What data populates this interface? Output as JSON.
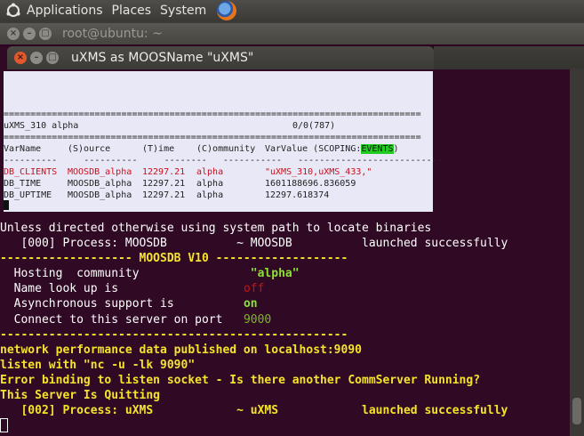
{
  "top_panel": {
    "menus": [
      "Applications",
      "Places",
      "System"
    ]
  },
  "back_window": {
    "title": "root@ubuntu: ~"
  },
  "front_window": {
    "title": "uXMS as MOOSName \"uXMS\""
  },
  "uxms": {
    "separator": "==============================================================================",
    "header_name": "uXMS_310 alpha",
    "header_count": "0/0(787)",
    "columns": {
      "varname": "VarName",
      "source": "(S)ource",
      "time": "(T)ime",
      "community": "(C)ommunity",
      "value": "VarValue (SCOPING:",
      "events": "EVENTS",
      "close": ")"
    },
    "dashes": "----------     ----------     --------   -----------   ---------------------------",
    "rows": [
      {
        "var": "DB_CLIENTS",
        "src": "MOOSDB_alpha",
        "time": "12297.21",
        "comm": "alpha",
        "val": "\"uXMS_310,uXMS_433,\""
      },
      {
        "var": "DB_TIME",
        "src": "MOOSDB_alpha",
        "time": "12297.21",
        "comm": "alpha",
        "val": "1601188696.836059"
      },
      {
        "var": "DB_UPTIME",
        "src": "MOOSDB_alpha",
        "time": "12297.21",
        "comm": "alpha",
        "val": "12297.618374"
      }
    ]
  },
  "terminal": {
    "l1": "Unless directed otherwise using system path to locate binaries",
    "l2_a": "   [000] Process: MOOSDB          ~ MOOSDB          ",
    "l2_b": "launched successfully",
    "l3": "------------------- MOOSDB V10 -------------------",
    "l4_label": "  Hosting  community                ",
    "l4_value": "\"alpha\"",
    "l5_label": "  Name look up is                  ",
    "l5_value": "off",
    "l6_label": "  Asynchronous support is          ",
    "l6_value": "on",
    "l7_label": "  Connect to this server on port   ",
    "l7_value": "9000",
    "l8": "--------------------------------------------------",
    "l9": "network performance data published on localhost:9090",
    "l10": "listen with \"nc -u -lk 9090\"",
    "l11": "Error binding to listen socket - Is there another CommServer Running?",
    "l12": "This Server Is Quitting",
    "l13_a": "   [002] Process: uXMS            ~ uXMS            ",
    "l13_b": "launched successfully"
  }
}
